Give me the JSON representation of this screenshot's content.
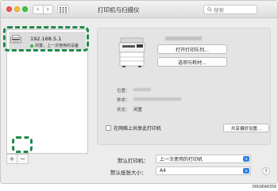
{
  "window": {
    "title": "打印机与扫描仪",
    "search_placeholder": "搜索",
    "back_icon": "chevron-left-icon",
    "forward_icon": "chevron-right-icon",
    "grid_icon": "grid-icon",
    "search_icon": "magnifier-icon"
  },
  "printer_list": {
    "items": [
      {
        "name": "192.168.5.1",
        "status": "闲置，上一次使用的设备",
        "status_color": "#38b44a"
      }
    ],
    "add_label": "+",
    "remove_label": "−"
  },
  "detail": {
    "open_queue_label": "打开打印队列...",
    "options_label": "选项与耗材...",
    "location_label": "位置：",
    "kind_label": "种类：",
    "state_label": "状态：",
    "state_value": "闲置",
    "share_label": "在网络上共享此打印机",
    "share_settings_label": "共享偏好设置..."
  },
  "settings": {
    "default_printer_label": "默认打印机：",
    "default_printer_value": "上一次使用的打印机",
    "paper_size_label": "默认纸张大小：",
    "paper_size_value": "A4",
    "help_label": "?"
  },
  "accent_color": "#2d7fe0",
  "highlight_color": "#1f8a4a",
  "caption": "D0G9DA8356"
}
